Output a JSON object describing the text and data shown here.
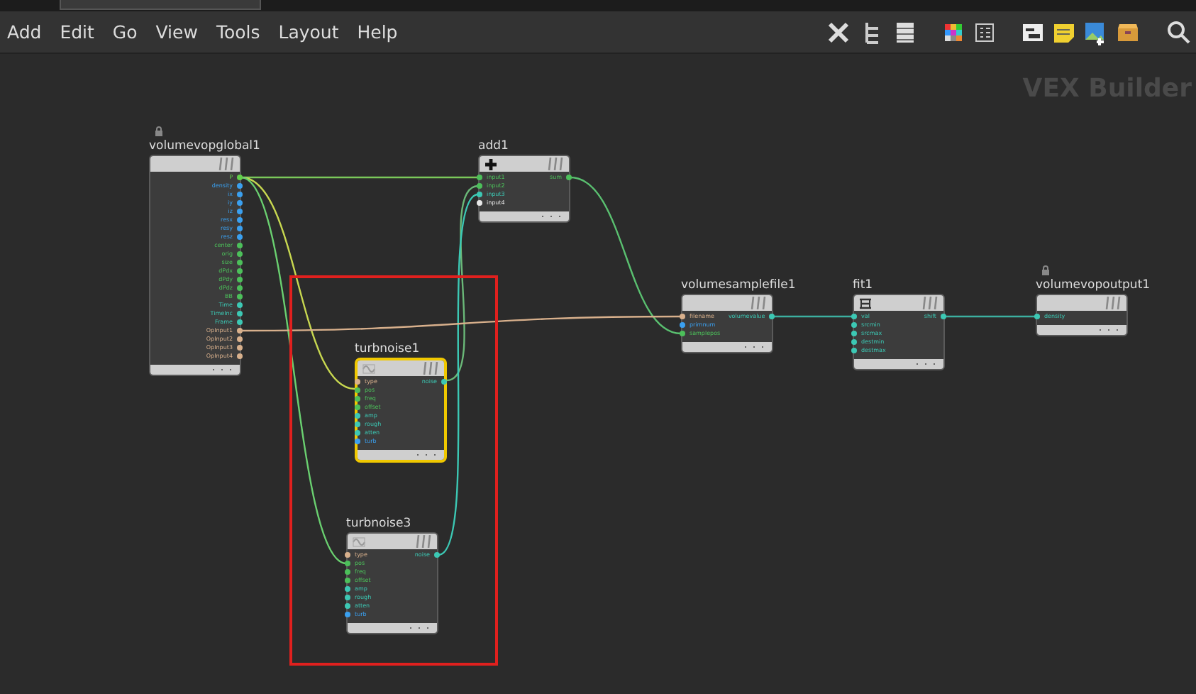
{
  "menu": [
    "Add",
    "Edit",
    "Go",
    "View",
    "Tools",
    "Layout",
    "Help"
  ],
  "canvas_label": "VEX Builder",
  "highlight": {
    "color": "#e0201e"
  },
  "nodes": [
    {
      "name": "volumevopglobal1",
      "locked": true,
      "selected": false,
      "outputs": [
        {
          "label": "P",
          "color": "#62d04a"
        },
        {
          "label": "density",
          "color": "#3aa0f0"
        },
        {
          "label": "ix",
          "color": "#3aa0f0"
        },
        {
          "label": "iy",
          "color": "#3aa0f0"
        },
        {
          "label": "iz",
          "color": "#3aa0f0"
        },
        {
          "label": "resx",
          "color": "#3aa0f0"
        },
        {
          "label": "resy",
          "color": "#3aa0f0"
        },
        {
          "label": "resz",
          "color": "#3aa0f0"
        },
        {
          "label": "center",
          "color": "#4cc05a"
        },
        {
          "label": "orig",
          "color": "#4cc05a"
        },
        {
          "label": "size",
          "color": "#4cc05a"
        },
        {
          "label": "dPdx",
          "color": "#4cc05a"
        },
        {
          "label": "dPdy",
          "color": "#4cc05a"
        },
        {
          "label": "dPdz",
          "color": "#4cc05a"
        },
        {
          "label": "BB",
          "color": "#4cc05a"
        },
        {
          "label": "Time",
          "color": "#3cc8b4"
        },
        {
          "label": "TimeInc",
          "color": "#3cc8b4"
        },
        {
          "label": "Frame",
          "color": "#3cc8b4"
        },
        {
          "label": "OpInput1",
          "color": "#d8b08c"
        },
        {
          "label": "OpInput2",
          "color": "#d8b08c"
        },
        {
          "label": "OpInput3",
          "color": "#d8b08c"
        },
        {
          "label": "OpInput4",
          "color": "#d8b08c"
        }
      ]
    },
    {
      "name": "add1",
      "locked": false,
      "selected": false,
      "inputs": [
        {
          "label": "input1",
          "color": "#4cc05a"
        },
        {
          "label": "input2",
          "color": "#4cc05a"
        },
        {
          "label": "input3",
          "color": "#3cc8b4"
        },
        {
          "label": "input4",
          "color": "#e8e8e8"
        }
      ],
      "outputs": [
        {
          "label": "sum",
          "color": "#4cc05a"
        }
      ]
    },
    {
      "name": "turbnoise1",
      "locked": false,
      "selected": true,
      "inputs": [
        {
          "label": "type",
          "color": "#d8b08c"
        },
        {
          "label": "pos",
          "color": "#4cc05a"
        },
        {
          "label": "freq",
          "color": "#4cc05a"
        },
        {
          "label": "offset",
          "color": "#4cc05a"
        },
        {
          "label": "amp",
          "color": "#3cc8b4"
        },
        {
          "label": "rough",
          "color": "#3cc8b4"
        },
        {
          "label": "atten",
          "color": "#3cc8b4"
        },
        {
          "label": "turb",
          "color": "#3aa0f0"
        }
      ],
      "outputs": [
        {
          "label": "noise",
          "color": "#3cc8b4"
        }
      ]
    },
    {
      "name": "turbnoise3",
      "locked": false,
      "selected": false,
      "inputs": [
        {
          "label": "type",
          "color": "#d8b08c"
        },
        {
          "label": "pos",
          "color": "#4cc05a"
        },
        {
          "label": "freq",
          "color": "#4cc05a"
        },
        {
          "label": "offset",
          "color": "#4cc05a"
        },
        {
          "label": "amp",
          "color": "#3cc8b4"
        },
        {
          "label": "rough",
          "color": "#3cc8b4"
        },
        {
          "label": "atten",
          "color": "#3cc8b4"
        },
        {
          "label": "turb",
          "color": "#3aa0f0"
        }
      ],
      "outputs": [
        {
          "label": "noise",
          "color": "#3cc8b4"
        }
      ]
    },
    {
      "name": "volumesamplefile1",
      "locked": false,
      "selected": false,
      "inputs": [
        {
          "label": "filename",
          "color": "#d8b08c"
        },
        {
          "label": "primnum",
          "color": "#3aa0f0"
        },
        {
          "label": "samplepos",
          "color": "#4cc05a"
        }
      ],
      "outputs": [
        {
          "label": "volumevalue",
          "color": "#3cc8b4"
        }
      ]
    },
    {
      "name": "fit1",
      "locked": false,
      "selected": false,
      "inputs": [
        {
          "label": "val",
          "color": "#3cc8b4"
        },
        {
          "label": "srcmin",
          "color": "#3cc8b4"
        },
        {
          "label": "srcmax",
          "color": "#3cc8b4"
        },
        {
          "label": "destmin",
          "color": "#3cc8b4"
        },
        {
          "label": "destmax",
          "color": "#3cc8b4"
        }
      ],
      "outputs": [
        {
          "label": "shift",
          "color": "#3cc8b4"
        }
      ]
    },
    {
      "name": "volumevopoutput1",
      "locked": true,
      "selected": false,
      "inputs": [
        {
          "label": "density",
          "color": "#3cc8b4"
        }
      ]
    }
  ]
}
